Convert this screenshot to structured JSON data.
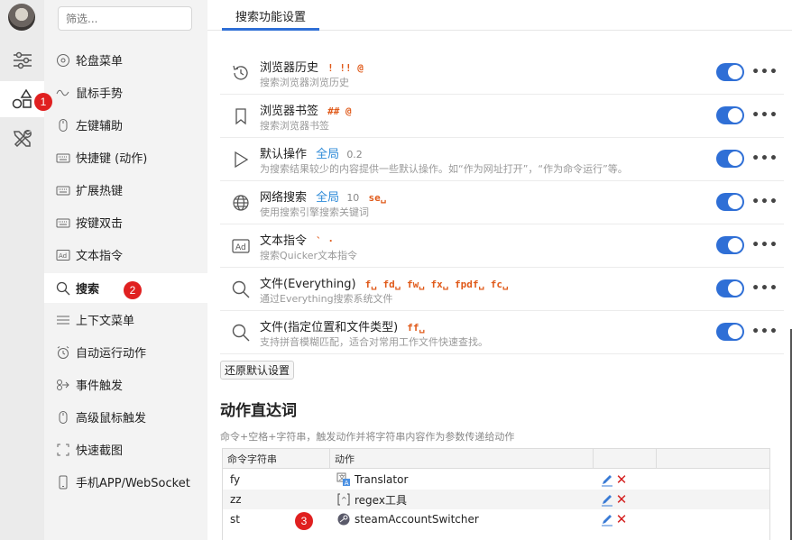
{
  "rail": {
    "items": [
      {
        "name": "sliders-icon"
      },
      {
        "name": "shapes-icon",
        "active": true
      },
      {
        "name": "tools-icon"
      }
    ]
  },
  "markers": {
    "one": "1",
    "two": "2",
    "three": "3"
  },
  "sidebar": {
    "filter_placeholder": "筛选...",
    "items": [
      {
        "label": "轮盘菜单",
        "icon": "wheel-icon"
      },
      {
        "label": "鼠标手势",
        "icon": "wave-icon"
      },
      {
        "label": "左键辅助",
        "icon": "mouse-icon"
      },
      {
        "label": "快捷键 (动作)",
        "icon": "keyboard-icon"
      },
      {
        "label": "扩展热键",
        "icon": "keyboard-icon"
      },
      {
        "label": "按键双击",
        "icon": "keyboard-icon"
      },
      {
        "label": "文本指令",
        "icon": "ad-icon"
      },
      {
        "label": "搜索",
        "icon": "search-icon",
        "active": true
      },
      {
        "label": "上下文菜单",
        "icon": "menu-icon"
      },
      {
        "label": "自动运行动作",
        "icon": "clock-icon"
      },
      {
        "label": "事件触发",
        "icon": "event-icon"
      },
      {
        "label": "高级鼠标触发",
        "icon": "mouse-icon"
      },
      {
        "label": "快速截图",
        "icon": "crop-icon"
      },
      {
        "label": "手机APP/WebSocket",
        "icon": "phone-icon"
      }
    ]
  },
  "main": {
    "tab": "搜索功能设置",
    "features": [
      {
        "title": "浏览器历史",
        "scope": "",
        "weight": "",
        "prefix": "! !! @",
        "desc": "搜索浏览器浏览历史",
        "icon": "history-icon",
        "enabled": true
      },
      {
        "title": "浏览器书签",
        "scope": "",
        "weight": "",
        "prefix": "## @",
        "desc": "搜索浏览器书签",
        "icon": "bookmark-icon",
        "enabled": true
      },
      {
        "title": "默认操作",
        "scope": "全局",
        "weight": "0.2",
        "prefix": "",
        "desc": "为搜索结果较少的内容提供一些默认操作。如“作为网址打开”，“作为命令运行”等。",
        "icon": "play-icon",
        "enabled": true
      },
      {
        "title": "网络搜索",
        "scope": "全局",
        "weight": "10",
        "prefix": "se␣",
        "desc": "使用搜索引擎搜索关键词",
        "icon": "globe-icon",
        "enabled": true
      },
      {
        "title": "文本指令",
        "scope": "",
        "weight": "",
        "prefix": "` ·",
        "desc": "搜索Quicker文本指令",
        "icon": "ad-icon",
        "enabled": true
      },
      {
        "title": "文件(Everything)",
        "scope": "",
        "weight": "",
        "prefix": "f␣ fd␣ fw␣ fx␣ fpdf␣ fc␣",
        "desc": "通过Everything搜索系统文件",
        "icon": "search-icon",
        "enabled": true
      },
      {
        "title": "文件(指定位置和文件类型)",
        "scope": "",
        "weight": "",
        "prefix": "ff␣",
        "desc": "支持拼音模糊匹配，适合对常用工作文件快速查找。",
        "icon": "search-icon",
        "enabled": true
      }
    ],
    "more_label": "•••",
    "reset_label": "还原默认设置",
    "section_title": "动作直达词",
    "section_desc": "命令+空格+字符串，触发动作并将字符串内容作为参数传递给动作",
    "table": {
      "headers": [
        "命令字符串",
        "动作",
        "",
        ""
      ],
      "rows": [
        {
          "cmd": "fy",
          "action": "Translator",
          "icon": "translate-icon"
        },
        {
          "cmd": "zz",
          "action": "regex工具",
          "icon": "regex-icon"
        },
        {
          "cmd": "st",
          "action": "steamAccountSwitcher",
          "icon": "steam-icon"
        }
      ]
    },
    "delete_glyph": "✕"
  }
}
